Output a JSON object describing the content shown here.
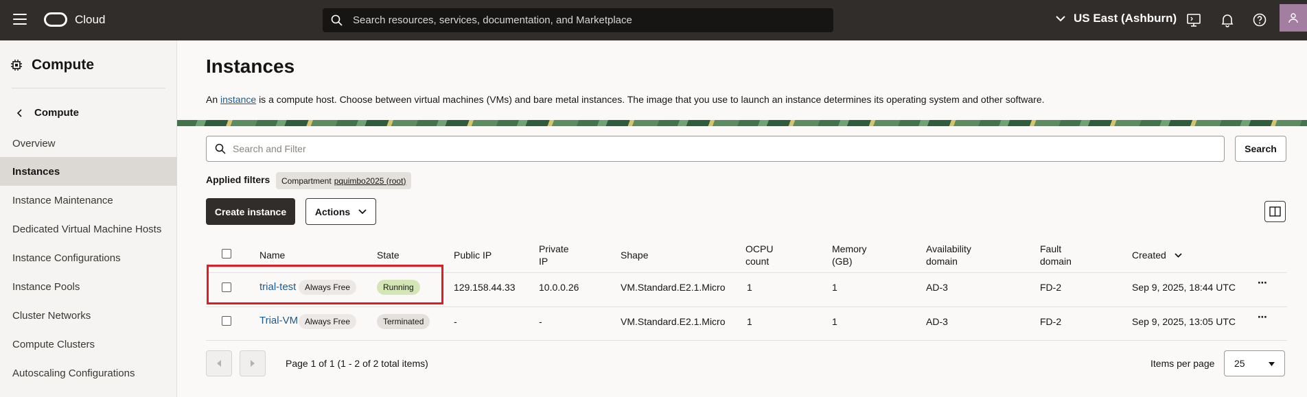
{
  "topbar": {
    "brand": "Cloud",
    "search_placeholder": "Search resources, services, documentation, and Marketplace",
    "region": "US East (Ashburn)"
  },
  "sidebar": {
    "section_title": "Compute",
    "back_label": "Compute",
    "items": [
      {
        "label": "Overview"
      },
      {
        "label": "Instances",
        "active": true
      },
      {
        "label": "Instance Maintenance"
      },
      {
        "label": "Dedicated Virtual Machine Hosts"
      },
      {
        "label": "Instance Configurations"
      },
      {
        "label": "Instance Pools"
      },
      {
        "label": "Cluster Networks"
      },
      {
        "label": "Compute Clusters"
      },
      {
        "label": "Autoscaling Configurations"
      }
    ]
  },
  "main": {
    "title": "Instances",
    "desc_prefix": "An",
    "desc_link": "instance",
    "desc_suffix": "is a compute host. Choose between virtual machines (VMs) and bare metal instances. The image that you use to launch an instance determines its operating system and other software.",
    "filter_placeholder": "Search and Filter",
    "search_label": "Search",
    "applied_filters_label": "Applied filters",
    "chip_label": "Compartment",
    "chip_value": "pquimbo2025 (root)",
    "create_label": "Create instance",
    "actions_label": "Actions"
  },
  "table": {
    "headers": {
      "name": "Name",
      "state": "State",
      "public_ip": "Public IP",
      "private_ip_1": "Private",
      "private_ip_2": "IP",
      "shape": "Shape",
      "ocpu_1": "OCPU",
      "ocpu_2": "count",
      "memory_1": "Memory",
      "memory_2": "(GB)",
      "ad_1": "Availability",
      "ad_2": "domain",
      "fd_1": "Fault",
      "fd_2": "domain",
      "created": "Created"
    },
    "rows": [
      {
        "name": "trial-test",
        "badge": "Always Free",
        "state": "Running",
        "public_ip": "129.158.44.33",
        "private_ip": "10.0.0.26",
        "shape": "VM.Standard.E2.1.Micro",
        "ocpu": "1",
        "memory": "1",
        "ad": "AD-3",
        "fd": "FD-2",
        "created": "Sep 9, 2025, 18:44 UTC"
      },
      {
        "name": "Trial-VM",
        "badge": "Always Free",
        "state": "Terminated",
        "public_ip": "-",
        "private_ip": "-",
        "shape": "VM.Standard.E2.1.Micro",
        "ocpu": "1",
        "memory": "1",
        "ad": "AD-3",
        "fd": "FD-2",
        "created": "Sep 9, 2025, 13:05 UTC"
      }
    ]
  },
  "pagination": {
    "page_text": "Page 1 of 1 (1 - 2 of 2 total items)",
    "items_per_page_label": "Items per page",
    "items_per_page_value": "25"
  }
}
